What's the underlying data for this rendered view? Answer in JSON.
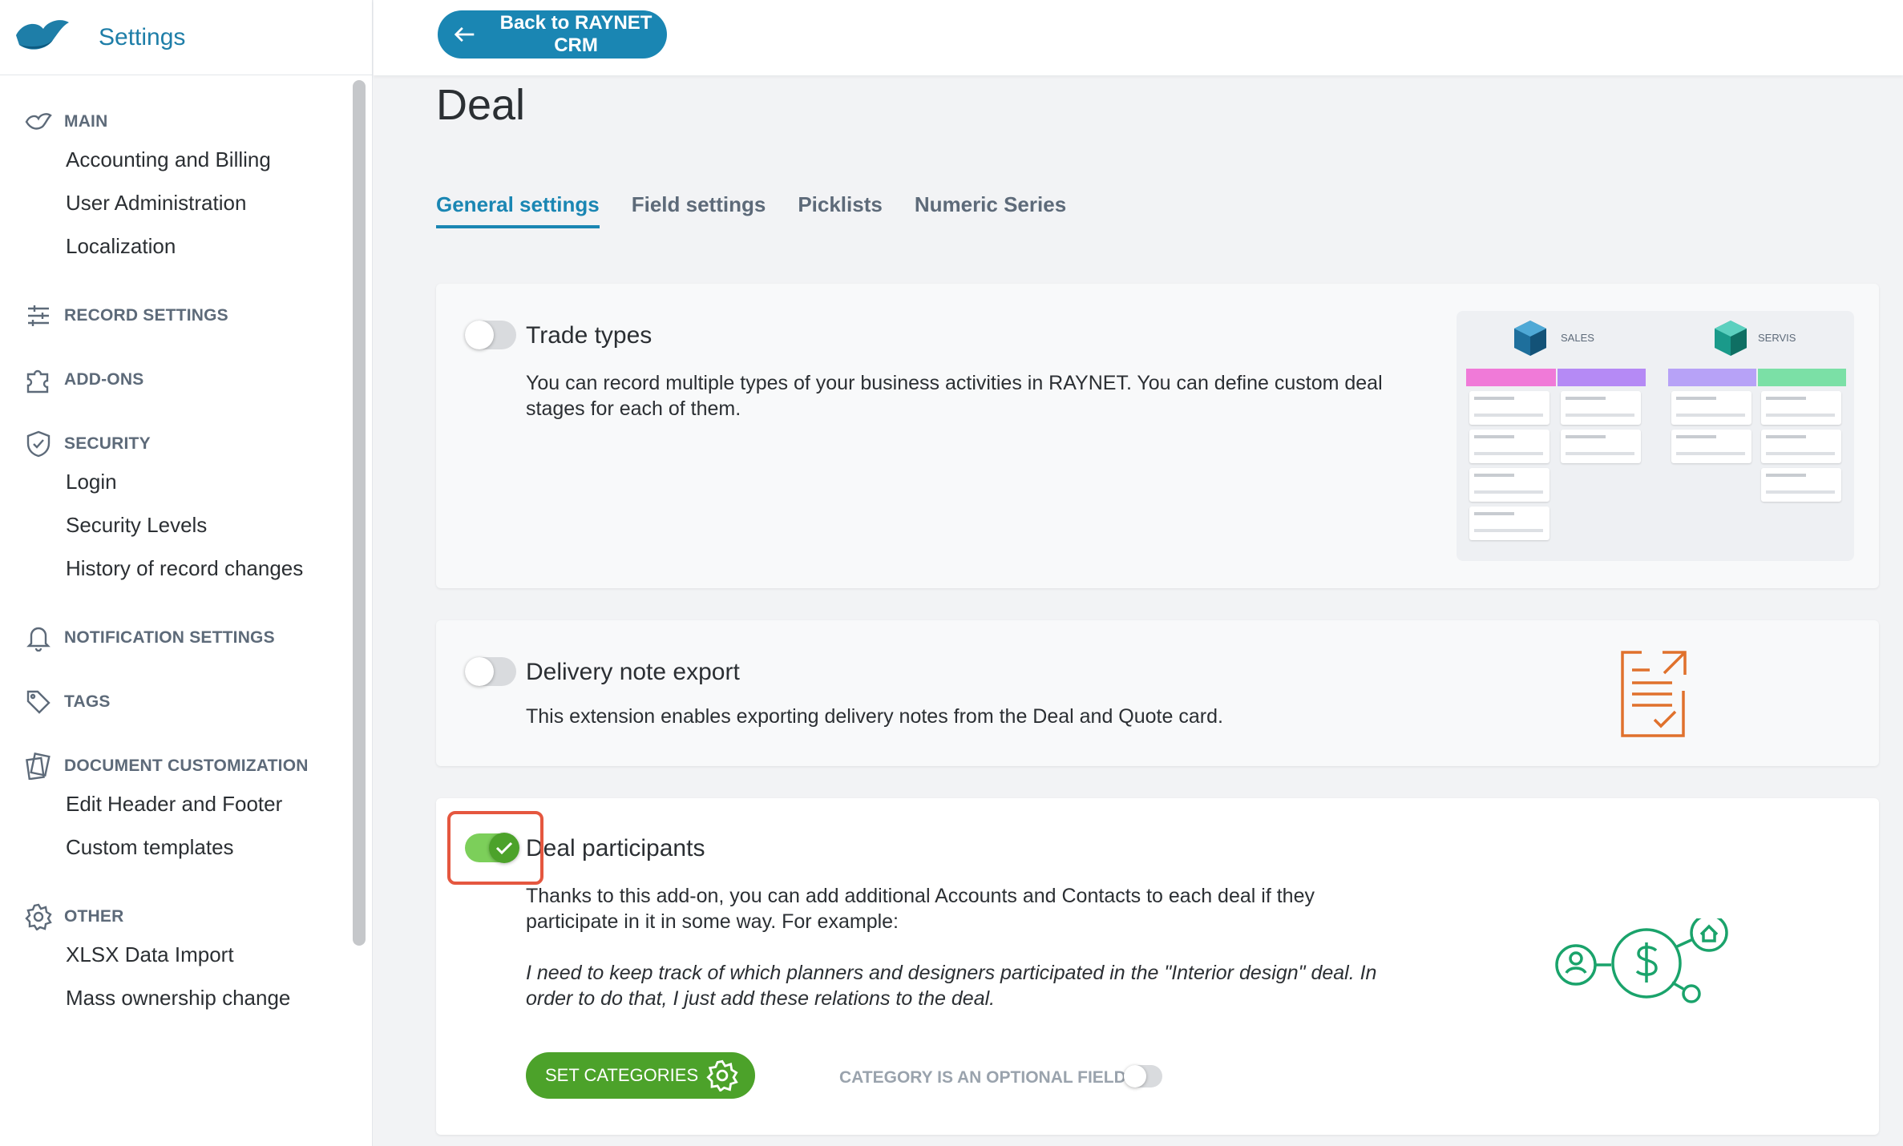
{
  "sidebar": {
    "brand_title": "Settings",
    "sections": [
      {
        "label": "MAIN",
        "icon": "main-icon",
        "items": [
          "Accounting and Billing",
          "User Administration",
          "Localization"
        ]
      },
      {
        "label": "RECORD SETTINGS",
        "icon": "sliders-icon",
        "items": []
      },
      {
        "label": "ADD-ONS",
        "icon": "puzzle-icon",
        "items": []
      },
      {
        "label": "SECURITY",
        "icon": "shield-icon",
        "items": [
          "Login",
          "Security Levels",
          "History of record changes"
        ]
      },
      {
        "label": "NOTIFICATION SETTINGS",
        "icon": "bell-icon",
        "items": []
      },
      {
        "label": "TAGS",
        "icon": "tag-icon",
        "items": []
      },
      {
        "label": "DOCUMENT CUSTOMIZATION",
        "icon": "documents-icon",
        "items": [
          "Edit Header and Footer",
          "Custom templates"
        ]
      },
      {
        "label": "OTHER",
        "icon": "gear-icon",
        "items": [
          "XLSX Data Import",
          "Mass ownership change"
        ]
      }
    ]
  },
  "topbar": {
    "back_label": "Back to RAYNET CRM"
  },
  "page": {
    "title": "Deal"
  },
  "tabs": [
    "General settings",
    "Field settings",
    "Picklists",
    "Numeric Series"
  ],
  "active_tab": "General settings",
  "cards": {
    "trade_types": {
      "title": "Trade types",
      "description": "You can record multiple types of your business activities in RAYNET. You can define custom deal stages for each of them.",
      "enabled": false,
      "illustration": {
        "pipeline_1": "SALES",
        "pipeline_2": "SERVIS"
      }
    },
    "delivery_note": {
      "title": "Delivery note export",
      "description": "This extension enables exporting delivery notes from the Deal and Quote card.",
      "enabled": false
    },
    "deal_participants": {
      "title": "Deal participants",
      "description": "Thanks to this add-on, you can add additional Accounts and Contacts to each deal if they participate in it in some way. For example:",
      "example": "I need to keep track of which planners and designers participated in the \"Interior design\" deal. In order to do that, I just add these relations to the deal.",
      "enabled": true,
      "set_categories_label": "SET CATEGORIES",
      "optional_field_label": "CATEGORY IS AN OPTIONAL FIELD",
      "optional_field_enabled": false
    }
  },
  "colors": {
    "accent": "#1a86b3",
    "success": "#4ca22a",
    "highlight": "#e5573f",
    "orange": "#e0712c",
    "illus_green": "#1aa36b"
  }
}
